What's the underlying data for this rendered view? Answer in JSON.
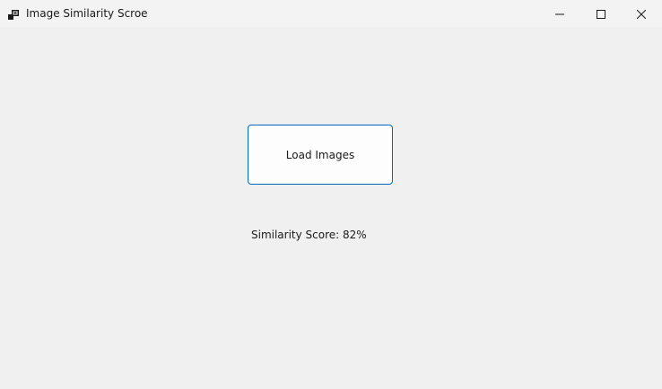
{
  "window": {
    "title": "Image Similarity Scroe",
    "icon": "app-window-icon",
    "controls": {
      "minimize_icon": "minimize-icon",
      "maximize_icon": "maximize-icon",
      "close_icon": "close-icon"
    }
  },
  "main": {
    "load_button_label": "Load Images",
    "score_text": "Similarity Score: 82%"
  },
  "colors": {
    "background": "#f0f0f0",
    "titlebar": "#f3f3f3",
    "button_border": "#0067c0",
    "button_fill": "#fdfdfd",
    "text": "#1a1a1a"
  }
}
